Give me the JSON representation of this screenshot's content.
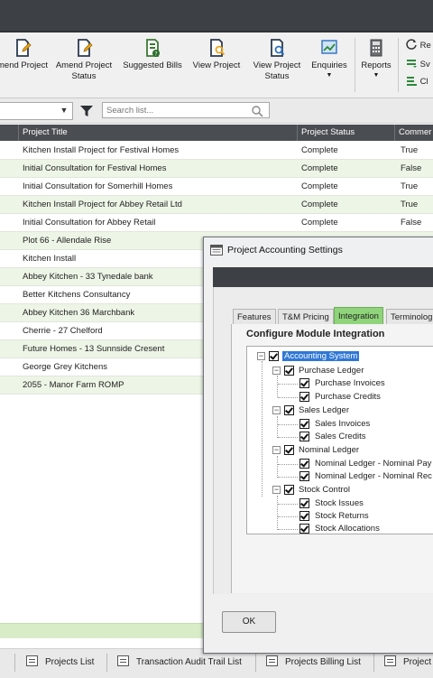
{
  "ribbon": {
    "buttons": [
      {
        "label": "mend Project",
        "icon": "amend-project-icon"
      },
      {
        "label": "Amend Project Status",
        "icon": "amend-project-status-icon"
      },
      {
        "label": "Suggested Bills",
        "icon": "suggested-bills-icon"
      },
      {
        "label": "View Project",
        "icon": "view-project-icon"
      },
      {
        "label": "View Project Status",
        "icon": "view-project-status-icon"
      },
      {
        "label": "Enquiries",
        "icon": "enquiries-icon"
      },
      {
        "label": "Reports",
        "icon": "reports-icon"
      }
    ],
    "small_buttons": [
      "Re",
      "Sv",
      "Cl"
    ]
  },
  "filter": {
    "search_placeholder": "Search list..."
  },
  "grid": {
    "columns": [
      "Project Title",
      "Project Status",
      "Commer"
    ],
    "rows": [
      {
        "title": "Kitchen Install Project for Festival Homes",
        "status": "Complete",
        "comm": "True"
      },
      {
        "title": "Initial Consultation for Festival Homes",
        "status": "Complete",
        "comm": "False"
      },
      {
        "title": "Initial Consultation for Somerhill Homes",
        "status": "Complete",
        "comm": "True"
      },
      {
        "title": "Kitchen Install Project for Abbey Retail Ltd",
        "status": "Complete",
        "comm": "True"
      },
      {
        "title": "Initial Consultation for Abbey Retail",
        "status": "Complete",
        "comm": "False"
      },
      {
        "title": "Plot 66 - Allendale Rise",
        "status": "",
        "comm": ""
      },
      {
        "title": "Kitchen Install",
        "status": "",
        "comm": ""
      },
      {
        "title": "Abbey Kitchen - 33 Tynedale bank",
        "status": "",
        "comm": ""
      },
      {
        "title": "Better Kitchens Consultancy",
        "status": "",
        "comm": ""
      },
      {
        "title": "Abbey Kitchen 36 Marchbank",
        "status": "",
        "comm": ""
      },
      {
        "title": "Cherrie - 27 Chelford",
        "status": "",
        "comm": ""
      },
      {
        "title": "Future Homes - 13 Sunnside Cresent",
        "status": "",
        "comm": ""
      },
      {
        "title": "George Grey Kitchens",
        "status": "",
        "comm": ""
      },
      {
        "title": "2055 - Manor Farm ROMP",
        "status": "",
        "comm": ""
      }
    ]
  },
  "bottom_tabs": [
    "Projects List",
    "Transaction Audit Trail List",
    "Projects Billing List",
    "Project"
  ],
  "dialog": {
    "title": "Project Accounting Settings",
    "tabs": [
      "Features",
      "T&M Pricing",
      "Integration",
      "Terminolog"
    ],
    "active_tab": "Integration",
    "section_title": "Configure Module Integration",
    "tree": {
      "root": "Accounting System",
      "groups": [
        {
          "label": "Purchase Ledger",
          "items": [
            "Purchase Invoices",
            "Purchase Credits"
          ]
        },
        {
          "label": "Sales Ledger",
          "items": [
            "Sales Invoices",
            "Sales Credits"
          ]
        },
        {
          "label": "Nominal Ledger",
          "items": [
            "Nominal Ledger - Nominal Pay",
            "Nominal Ledger - Nominal Rec"
          ]
        },
        {
          "label": "Stock Control",
          "items": [
            "Stock Issues",
            "Stock Returns",
            "Stock Allocations"
          ]
        }
      ]
    },
    "ok_label": "OK"
  },
  "colors": {
    "titlebar": "#3d4044",
    "grid_header": "#4a4d52",
    "alt_row": "#edf5e6",
    "active_tab": "#8fd47a",
    "selection": "#2f78d6"
  }
}
